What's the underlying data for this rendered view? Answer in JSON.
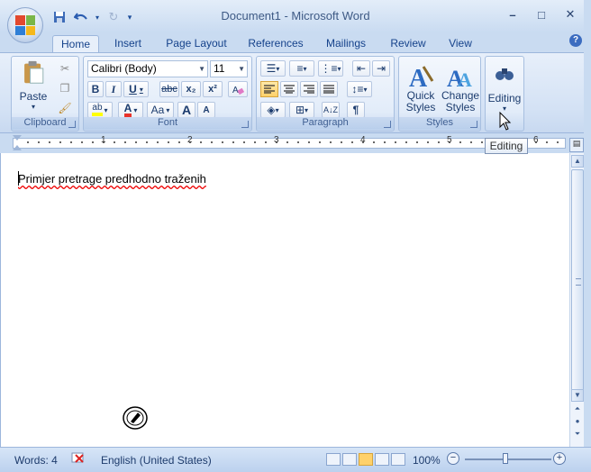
{
  "window": {
    "title": "Document1 - Microsoft Word"
  },
  "qat": {
    "save_icon": "save-icon",
    "undo_icon": "undo-icon",
    "redo_icon": "redo-icon",
    "customize_icon": "chevron-down-icon"
  },
  "tabs": [
    {
      "label": "Home",
      "active": true
    },
    {
      "label": "Insert"
    },
    {
      "label": "Page Layout"
    },
    {
      "label": "References"
    },
    {
      "label": "Mailings"
    },
    {
      "label": "Review"
    },
    {
      "label": "View"
    }
  ],
  "ribbon": {
    "clipboard": {
      "label": "Clipboard",
      "paste_label": "Paste"
    },
    "font": {
      "label": "Font",
      "font_name": "Calibri (Body)",
      "font_size": "11",
      "bold": "B",
      "italic": "I",
      "underline": "U",
      "strike": "abc",
      "subscript": "x₂",
      "superscript": "x²",
      "grow": "A",
      "shrink": "A",
      "change_case": "Aa",
      "highlight": "ab"
    },
    "paragraph": {
      "label": "Paragraph",
      "pilcrow": "¶"
    },
    "styles": {
      "label": "Styles",
      "quick_styles": "Quick Styles",
      "change_styles": "Change Styles"
    },
    "editing": {
      "label": "Editing"
    }
  },
  "ruler": {
    "numbers": [
      "1",
      "2",
      "3",
      "4",
      "5",
      "6"
    ],
    "tooltip": "Editing"
  },
  "document": {
    "text": "Primjer pretrage predhodno traženih"
  },
  "statusbar": {
    "words": "Words: 4",
    "language": "English (United States)",
    "zoom": "100%"
  },
  "colors": {
    "accent": "#15428b",
    "ribbon_bg": "#d4e2f5",
    "highlight": "#ffd16a"
  }
}
